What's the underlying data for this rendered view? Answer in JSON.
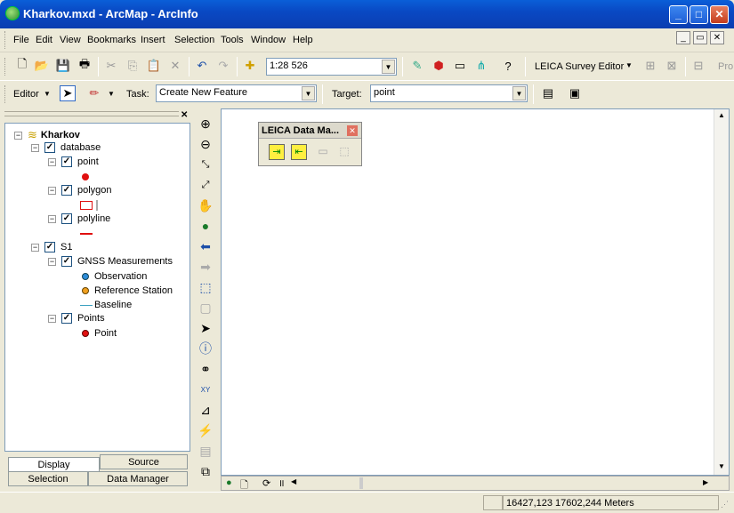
{
  "window": {
    "title": "Kharkov.mxd - ArcMap - ArcInfo",
    "minimize": "_",
    "maximize": "□",
    "close": "✕"
  },
  "menu": [
    "File",
    "Edit",
    "View",
    "Bookmarks",
    "Insert",
    "Selection",
    "Tools",
    "Window",
    "Help"
  ],
  "standard_toolbar": {
    "scale": "1:28 526",
    "leica_label": "LEICA Survey Editor",
    "trailing": "Pro"
  },
  "editor_toolbar": {
    "editor_label": "Editor",
    "task_label": "Task:",
    "task_value": "Create New Feature",
    "target_label": "Target:",
    "target_value": "point"
  },
  "toc": {
    "root": "Kharkov",
    "groups": [
      {
        "name": "database",
        "layers": [
          {
            "name": "point"
          },
          {
            "name": "polygon"
          },
          {
            "name": "polyline"
          }
        ]
      },
      {
        "name": "S1",
        "layers": [
          {
            "name": "GNSS Measurements",
            "legend": [
              "Observation",
              "Reference Station",
              "Baseline"
            ]
          },
          {
            "name": "Points",
            "legend": [
              "Point"
            ]
          }
        ]
      }
    ],
    "tabs": {
      "display": "Display",
      "source": "Source",
      "selection": "Selection",
      "data_manager": "Data Manager"
    }
  },
  "leica_panel": {
    "title": "LEICA Data Ma..."
  },
  "status": {
    "coords": "16427,123  17602,244 Meters"
  },
  "colors": {
    "title_blue": "#0a5fd8",
    "point_red": "#e01010",
    "observation_blue": "#2d8bd8",
    "reference_orange": "#f0a020",
    "baseline_teal": "#3aa0c0"
  }
}
